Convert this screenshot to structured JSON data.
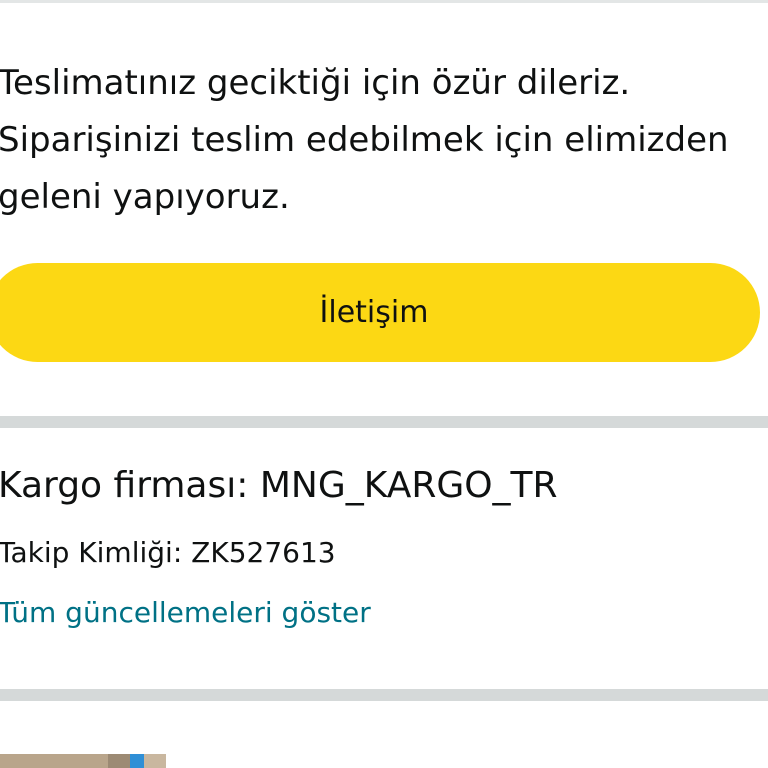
{
  "delivery_status": {
    "message": "Teslimatınız geciktiği için özür dileriz. Siparişinizi teslim edebilmek için elimizden geleni yapıyoruz."
  },
  "actions": {
    "contact_label": "İletişim"
  },
  "shipment": {
    "carrier_text": "Kargo firması: MNG_KARGO_TR",
    "tracking_text": "Takip Kimliği: ZK527613",
    "updates_link_text": "Tüm güncellemeleri göster"
  },
  "colors": {
    "button_yellow": "#fcd814",
    "link_teal": "#007185",
    "divider_gray": "#d5d9d9",
    "text_dark": "#0f1111"
  }
}
